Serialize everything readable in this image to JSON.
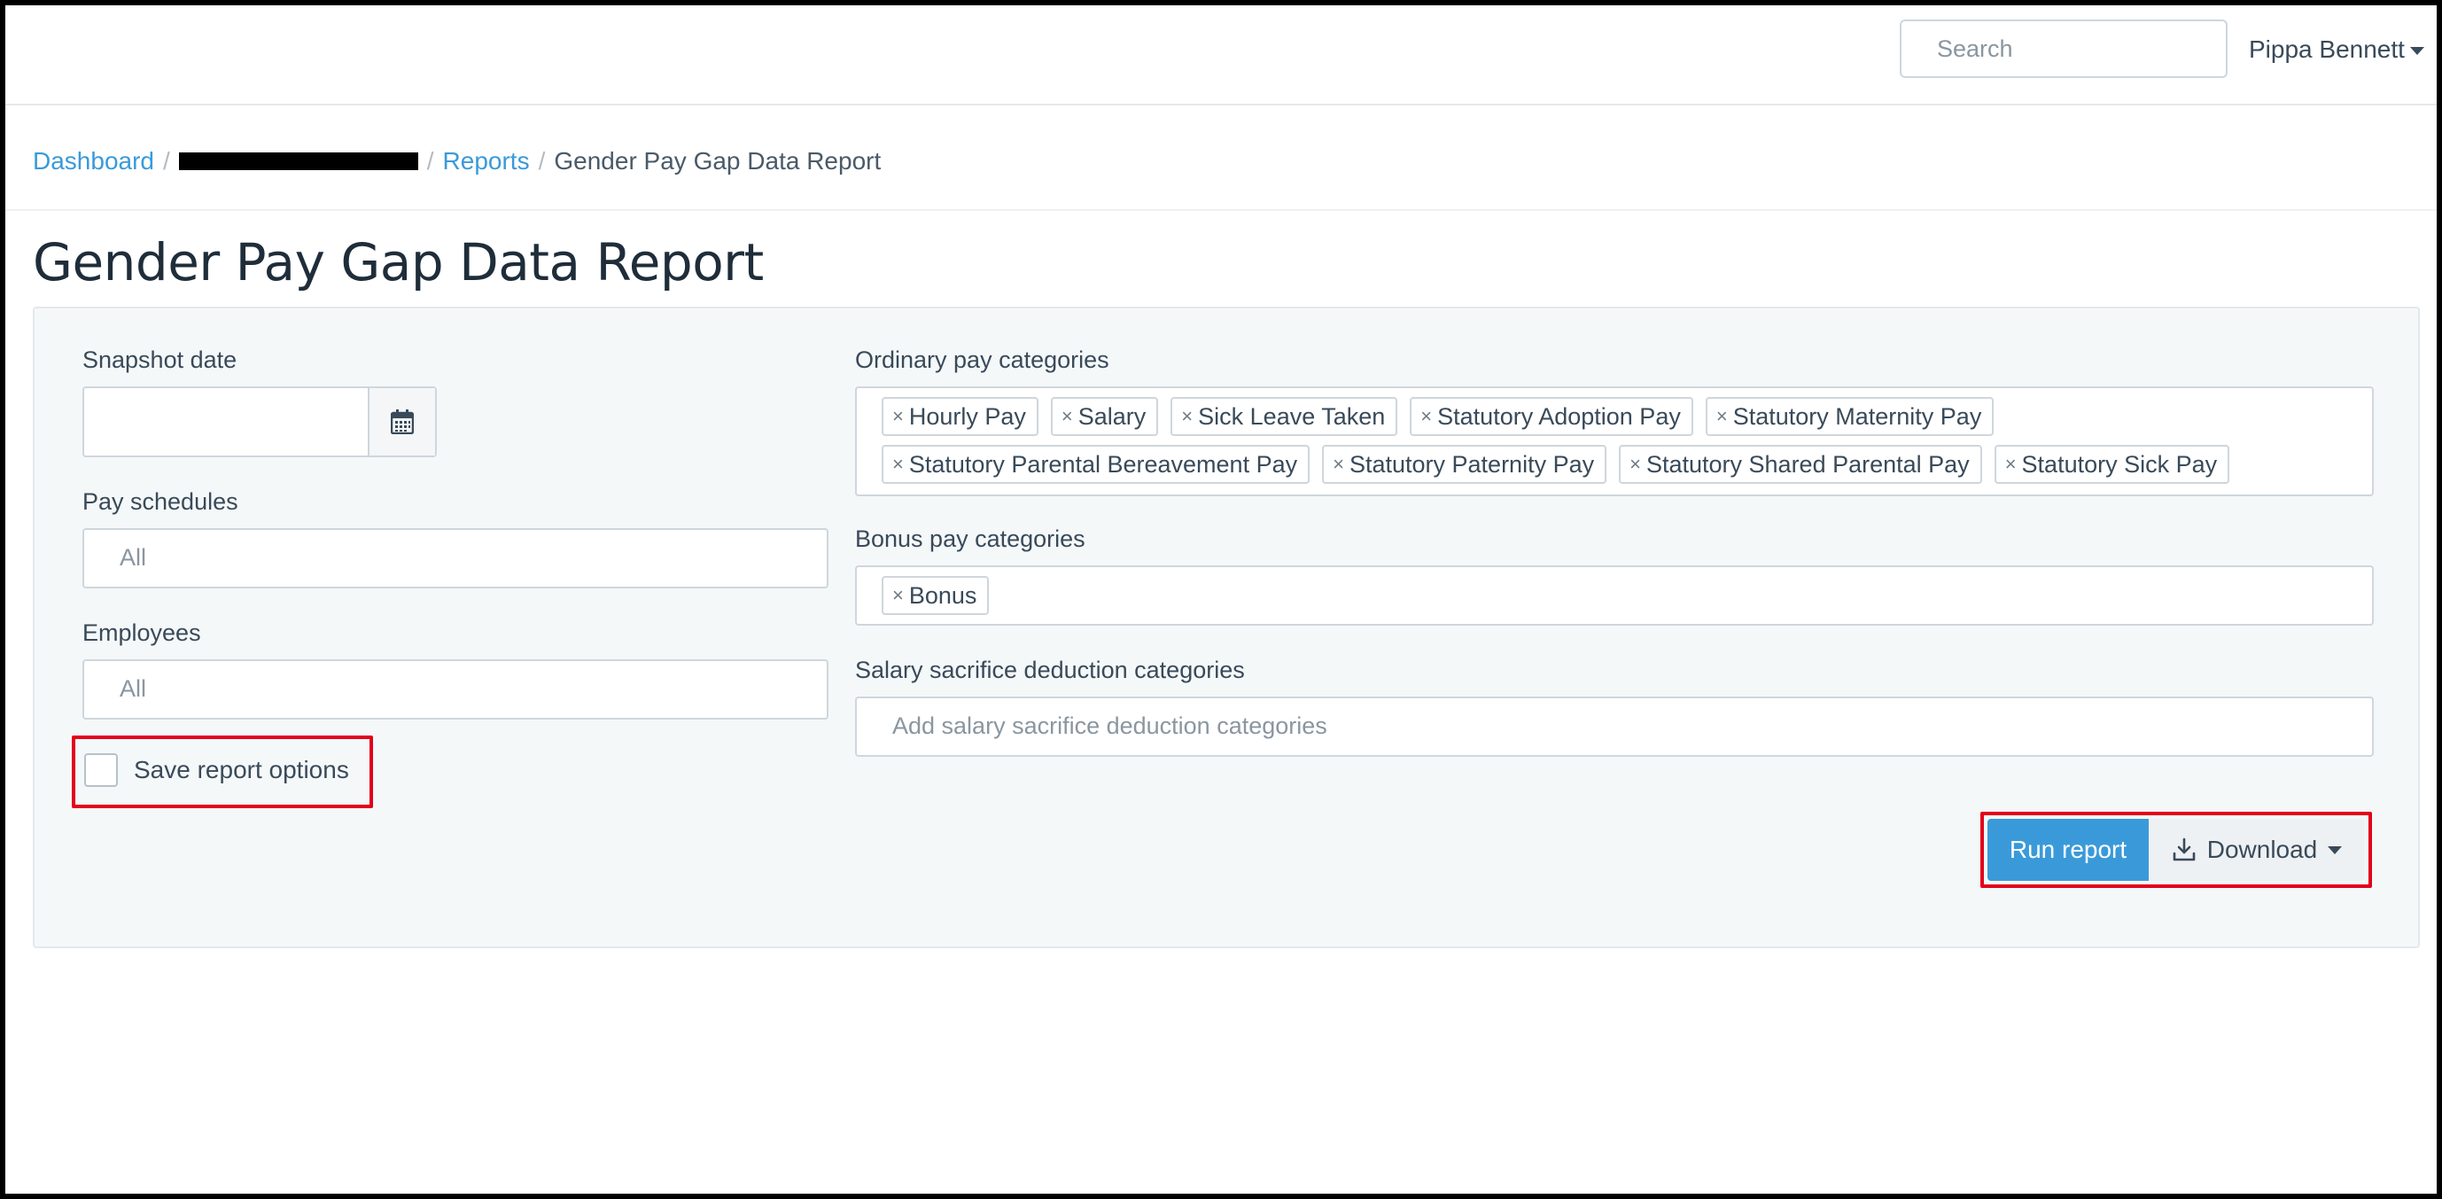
{
  "header": {
    "search_placeholder": "Search",
    "user_name": "Pippa Bennett"
  },
  "breadcrumb": {
    "dashboard": "Dashboard",
    "reports": "Reports",
    "current": "Gender Pay Gap Data Report"
  },
  "page": {
    "title": "Gender Pay Gap Data Report"
  },
  "form": {
    "snapshot_label": "Snapshot date",
    "snapshot_value": "",
    "pay_schedules_label": "Pay schedules",
    "pay_schedules_placeholder": "All",
    "employees_label": "Employees",
    "employees_placeholder": "All",
    "save_options_label": "Save report options",
    "ordinary_label": "Ordinary pay categories",
    "ordinary_tags_row1": [
      "Hourly Pay",
      "Salary",
      "Sick Leave Taken",
      "Statutory Adoption Pay",
      "Statutory Maternity Pay"
    ],
    "ordinary_tags_row2": [
      "Statutory Parental Bereavement Pay",
      "Statutory Paternity Pay",
      "Statutory Shared Parental Pay",
      "Statutory Sick Pay"
    ],
    "bonus_label": "Bonus pay categories",
    "bonus_tags": [
      "Bonus"
    ],
    "salary_sacrifice_label": "Salary sacrifice deduction categories",
    "salary_sacrifice_placeholder": "Add salary sacrifice deduction categories",
    "tag_remove_glyph": "×"
  },
  "actions": {
    "run_label": "Run report",
    "download_label": "Download"
  },
  "colors": {
    "accent": "#3a9ad9",
    "highlight": "#e3001b"
  }
}
